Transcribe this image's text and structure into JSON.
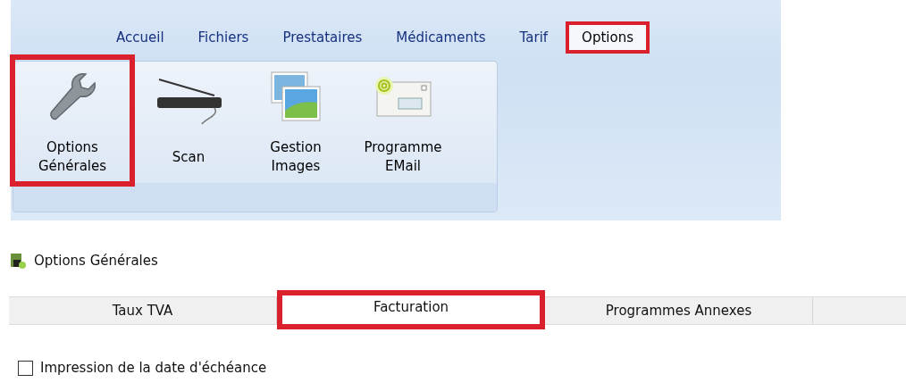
{
  "ribbon": {
    "tabs": [
      {
        "label": "Accueil",
        "selected": false,
        "highlighted": false
      },
      {
        "label": "Fichiers",
        "selected": false,
        "highlighted": false
      },
      {
        "label": "Prestataires",
        "selected": false,
        "highlighted": false
      },
      {
        "label": "Médicaments",
        "selected": false,
        "highlighted": false
      },
      {
        "label": "Tarif",
        "selected": false,
        "highlighted": false
      },
      {
        "label": "Options",
        "selected": true,
        "highlighted": true
      }
    ],
    "buttons": [
      {
        "kind": "wrench",
        "label": "Options\nGénérales",
        "highlighted": true
      },
      {
        "kind": "scanner",
        "label": "Scan",
        "highlighted": false
      },
      {
        "kind": "images",
        "label": "Gestion\nImages",
        "highlighted": false
      },
      {
        "kind": "email",
        "label": "Programme\nEMail",
        "highlighted": false
      }
    ]
  },
  "dialog": {
    "title": "Options Générales",
    "tabs": [
      {
        "label": "Taux TVA",
        "selected": false,
        "highlighted": false
      },
      {
        "label": "Facturation",
        "selected": true,
        "highlighted": true
      },
      {
        "label": "Programmes Annexes",
        "selected": false,
        "highlighted": false
      }
    ],
    "checkbox": {
      "label": "Impression de la date d'échéance",
      "checked": false
    }
  }
}
